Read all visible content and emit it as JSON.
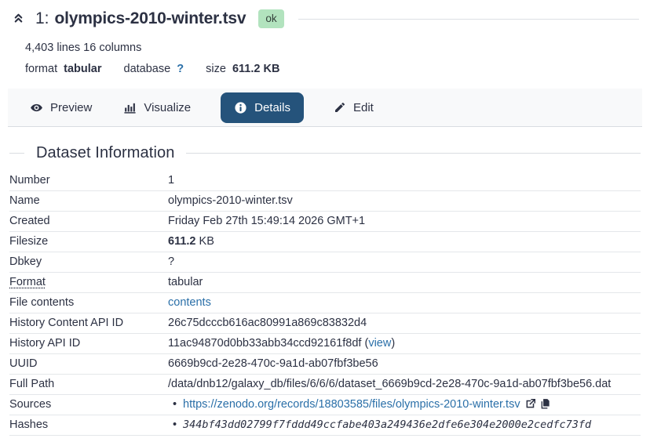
{
  "header": {
    "hid": "1:",
    "title": "olympics-2010-winter.tsv",
    "state_badge": "ok",
    "summary": "4,403 lines 16 columns",
    "attrs": {
      "format_label": "format",
      "format_value": "tabular",
      "database_label": "database",
      "database_value": "?",
      "size_label": "size",
      "size_value": "611.2 KB"
    }
  },
  "tabs": [
    {
      "label": "Preview",
      "icon": "eye-icon",
      "active": false
    },
    {
      "label": "Visualize",
      "icon": "bar-chart-icon",
      "active": false
    },
    {
      "label": "Details",
      "icon": "info-circle-icon",
      "active": true
    },
    {
      "label": "Edit",
      "icon": "pencil-icon",
      "active": false
    }
  ],
  "section": {
    "title": "Dataset Information"
  },
  "details": {
    "rows": [
      {
        "label": "Number",
        "value": "1"
      },
      {
        "label": "Name",
        "value": "olympics-2010-winter.tsv"
      },
      {
        "label": "Created",
        "value": "Friday Feb 27th 15:49:14 2026 GMT+1"
      },
      {
        "label": "Filesize",
        "value_bold": "611.2",
        "value_rest": " KB"
      },
      {
        "label": "Dbkey",
        "value": "?"
      },
      {
        "label": "Format",
        "value": "tabular"
      },
      {
        "label": "File contents",
        "link": "contents"
      },
      {
        "label": "History Content API ID",
        "value": "26c75dcccb616ac80991a869c83832d4"
      },
      {
        "label": "History API ID",
        "value": "11ac94870d0bb33abb34ccd92161f8df",
        "paren_open": " (",
        "link": "view",
        "paren_close": ")"
      },
      {
        "label": "UUID",
        "value": "6669b9cd-2e28-470c-9a1d-ab07fbf3be56"
      },
      {
        "label": "Full Path",
        "value": "/data/dnb12/galaxy_db/files/6/6/6/dataset_6669b9cd-2e28-470c-9a1d-ab07fbf3be56.dat"
      },
      {
        "label": "Sources",
        "link": "https://zenodo.org/records/18803585/files/olympics-2010-winter.tsv"
      },
      {
        "label": "Hashes",
        "value": "344bf43dd02799f7fddd49ccfabe403a249436e2dfe6e304e2000e2cedfc73fd"
      }
    ]
  },
  "colors": {
    "text": "#2c3143",
    "link": "#2a6fa8",
    "active_tab_bg": "#25537b",
    "ok_badge_bg": "#b2e3be",
    "band_bg": "#f8f9fa",
    "rule": "#d9dde1"
  }
}
